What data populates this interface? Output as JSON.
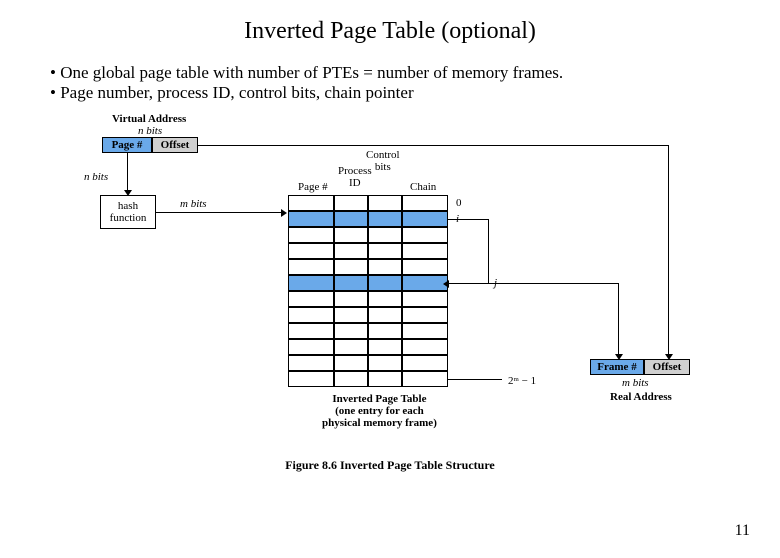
{
  "title": "Inverted Page Table (optional)",
  "bullets": [
    "One global page table with number of PTEs = number of memory frames.",
    "Page number, process ID, control bits, chain pointer"
  ],
  "diagram": {
    "virtual_address_label": "Virtual Address",
    "n_bits": "n bits",
    "page_hash_cell": "Page #",
    "offset_cell": "Offset",
    "hash_in_bits": "n bits",
    "hash_function": "hash\nfunction",
    "hash_out_bits": "m bits",
    "col_control_bits": "Control\nbits",
    "col_process_id": "Process\nID",
    "col_page": "Page #",
    "col_chain": "Chain",
    "idx_0": "0",
    "idx_i": "i",
    "idx_j": "j",
    "idx_last": "2ᵐ − 1",
    "table_caption": "Inverted Page Table\n(one entry for each\nphysical memory frame)",
    "frame_cell": "Frame #",
    "offset_cell2": "Offset",
    "m_bits": "m bits",
    "real_address": "Real Address",
    "figure_caption": "Figure 8.6   Inverted Page Table Structure"
  },
  "page_number": "11"
}
